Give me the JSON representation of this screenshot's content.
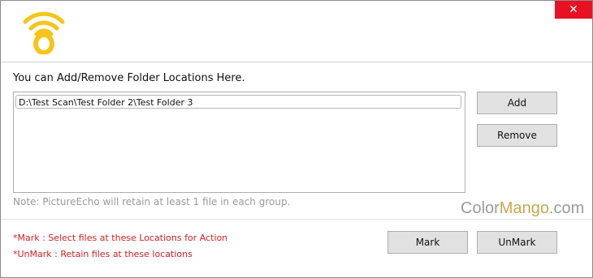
{
  "window": {
    "close_glyph": "✕",
    "accent": "#f5c518",
    "close_color": "#e81123"
  },
  "header": {
    "logo_icon": "wifi-signal-logo-icon"
  },
  "main": {
    "instruction": "You can Add/Remove Folder Locations Here.",
    "folders": [
      "D:\\Test Scan\\Test Folder 2\\Test Folder 3"
    ],
    "add_label": "Add",
    "remove_label": "Remove",
    "note": "Note: PictureEcho will retain at least 1 file in each group."
  },
  "watermark": {
    "part1": "Color",
    "part2": "Mango",
    "part3": ".com"
  },
  "footer": {
    "mark_hint": "*Mark : Select files at these Locations for Action",
    "unmark_hint": "*UnMark : Retain files at these locations",
    "mark_label": "Mark",
    "unmark_label": "UnMark"
  }
}
